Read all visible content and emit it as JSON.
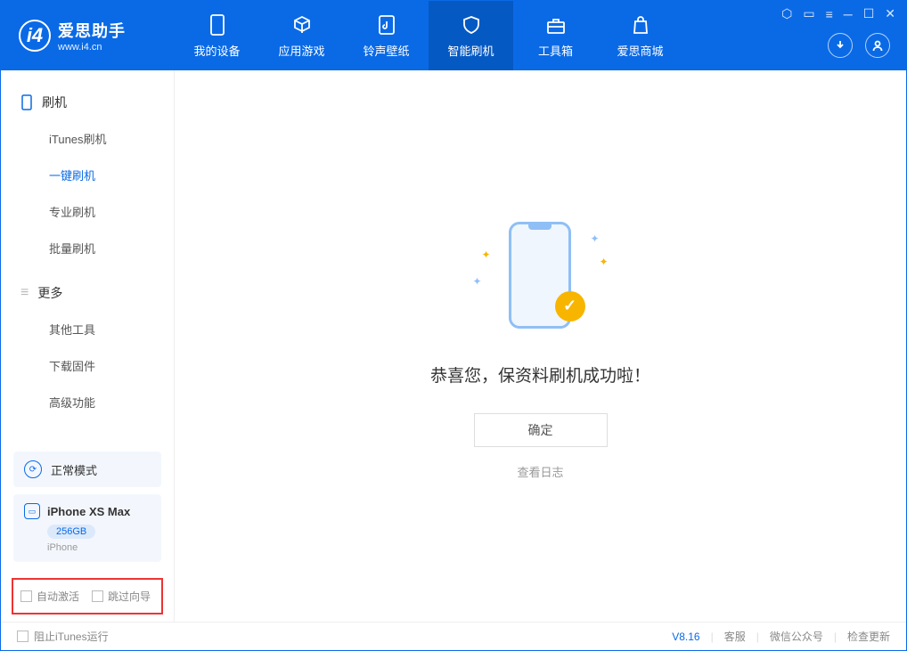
{
  "app": {
    "title": "爱思助手",
    "subtitle": "www.i4.cn"
  },
  "nav": {
    "tabs": [
      {
        "label": "我的设备"
      },
      {
        "label": "应用游戏"
      },
      {
        "label": "铃声壁纸"
      },
      {
        "label": "智能刷机"
      },
      {
        "label": "工具箱"
      },
      {
        "label": "爱思商城"
      }
    ]
  },
  "sidebar": {
    "section1": {
      "title": "刷机"
    },
    "items1": [
      {
        "label": "iTunes刷机"
      },
      {
        "label": "一键刷机"
      },
      {
        "label": "专业刷机"
      },
      {
        "label": "批量刷机"
      }
    ],
    "section2": {
      "title": "更多"
    },
    "items2": [
      {
        "label": "其他工具"
      },
      {
        "label": "下载固件"
      },
      {
        "label": "高级功能"
      }
    ],
    "mode_label": "正常模式",
    "device": {
      "name": "iPhone XS Max",
      "storage": "256GB",
      "type": "iPhone"
    },
    "checks": {
      "auto_activate": "自动激活",
      "skip_guide": "跳过向导"
    }
  },
  "main": {
    "success_msg": "恭喜您，保资料刷机成功啦！",
    "ok_btn": "确定",
    "log_link": "查看日志"
  },
  "footer": {
    "block_itunes": "阻止iTunes运行",
    "version": "V8.16",
    "support": "客服",
    "wechat": "微信公众号",
    "update": "检查更新"
  }
}
